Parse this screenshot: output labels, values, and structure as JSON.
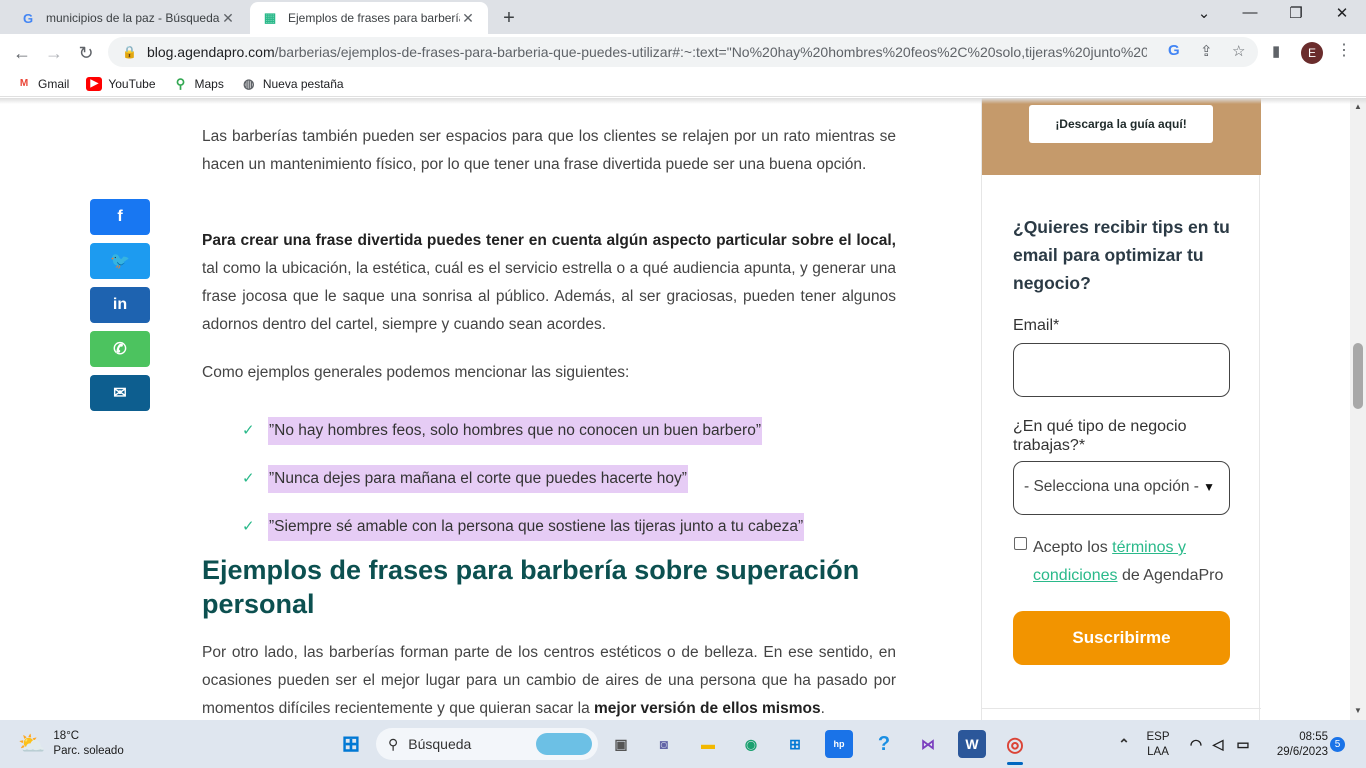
{
  "browser": {
    "tabs": [
      {
        "title": "municipios de la paz - Búsqueda",
        "favicon": "G"
      },
      {
        "title": "Ejemplos de frases para barbería",
        "favicon": "agendapro"
      }
    ],
    "new_tab": "+",
    "url": "blog.agendapro.com",
    "url_path": "/barberias/ejemplos-de-frases-para-barberia-que-puedes-utilizar#:~:text=\"No%20hay%20hombres%20feos%2C%20solo,tijeras%20junto%20...",
    "profile_initial": "E",
    "bookmarks": [
      "Gmail",
      "YouTube",
      "Maps",
      "Nueva pestaña"
    ]
  },
  "article": {
    "p1": "Las barberías también pueden ser espacios para que los clientes se relajen por un rato mientras se hacen un mantenimiento físico, por lo que tener una frase divertida puede ser una buena opción.",
    "p2_bold": "Para crear una frase divertida puedes tener en cuenta algún aspecto particular sobre el local,",
    "p2_rest": " tal como la ubicación, la estética, cuál es el servicio estrella o a qué audiencia apunta, y generar una frase jocosa que le saque una sonrisa al público. Además, al ser graciosas, pueden tener algunos adornos dentro del cartel, siempre y cuando sean acordes.",
    "p3": "Como ejemplos generales podemos mencionar las siguientes:",
    "list": [
      "”No hay hombres feos, solo hombres que no conocen un buen barbero”",
      "”Nunca dejes para mañana el corte que puedes hacerte hoy”",
      "”Siempre sé amable con la persona que sostiene las tijeras junto a tu cabeza”"
    ],
    "h2": "Ejemplos de frases para barbería sobre superación personal",
    "p4": "Por otro lado, las barberías forman parte de los centros estéticos o de belleza. En ese sentido, en ocasiones pueden ser el mejor lugar para un cambio de aires de una persona que ha pasado por momentos difíciles recientemente y que quieran sacar la ",
    "p4_bold": "mejor versión de ellos mismos",
    "p4_end": "."
  },
  "share": [
    {
      "name": "facebook",
      "glyph": "f",
      "color": "#1877f2"
    },
    {
      "name": "twitter",
      "glyph": "🐦",
      "color": "#1d9bf0"
    },
    {
      "name": "linkedin",
      "glyph": "in",
      "color": "#1e63b0"
    },
    {
      "name": "whatsapp",
      "glyph": "✆",
      "color": "#4cc35f"
    },
    {
      "name": "email",
      "glyph": "✉",
      "color": "#0d5e8f"
    }
  ],
  "sidebar": {
    "download_button": "¡Descarga la guía aquí!",
    "tips_title": "¿Quieres recibir tips en tu email para optimizar tu negocio?",
    "email_label": "Email",
    "required_mark": "*",
    "business_label": "¿En qué tipo de negocio trabajas?",
    "select_value": "- Selecciona una opción -",
    "accept_prefix": "Acepto los ",
    "accept_link": "términos y condiciones",
    "accept_suffix": " de AgendaPro",
    "subscribe": "Suscribirme"
  },
  "taskbar": {
    "temp": "18°C",
    "weather": "Parc. soleado",
    "search": "Búsqueda",
    "lang1": "ESP",
    "lang2": "LAA",
    "time": "08:55",
    "date": "29/6/2023",
    "notifications": "5"
  },
  "colors": {
    "heading": "#0c5050",
    "highlight": "#e6ccf5",
    "accent_green": "#2ab98a",
    "subscribe": "#f29400",
    "banner": "#c59a6b"
  }
}
